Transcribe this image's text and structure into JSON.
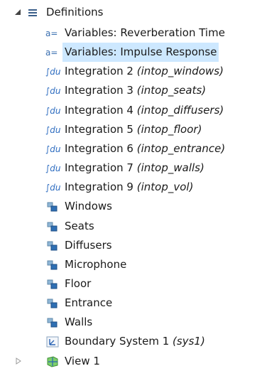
{
  "tree": {
    "definitions": {
      "label": "Definitions"
    },
    "children": [
      {
        "kind": "variables",
        "label": "Variables: Reverberation Time",
        "tag": "",
        "icon": "variables-icon",
        "icon_text": "a="
      },
      {
        "kind": "variables",
        "label": "Variables: Impulse Response",
        "tag": "",
        "icon": "variables-icon",
        "icon_text": "a=",
        "selected": true
      },
      {
        "kind": "integration",
        "label": "Integration 2",
        "tag": "(intop_windows)",
        "icon": "integration-icon",
        "icon_text": "∫du"
      },
      {
        "kind": "integration",
        "label": "Integration 3",
        "tag": "(intop_seats)",
        "icon": "integration-icon",
        "icon_text": "∫du"
      },
      {
        "kind": "integration",
        "label": "Integration 4",
        "tag": "(intop_diffusers)",
        "icon": "integration-icon",
        "icon_text": "∫du"
      },
      {
        "kind": "integration",
        "label": "Integration 5",
        "tag": "(intop_floor)",
        "icon": "integration-icon",
        "icon_text": "∫du"
      },
      {
        "kind": "integration",
        "label": "Integration 6",
        "tag": "(intop_entrance)",
        "icon": "integration-icon",
        "icon_text": "∫du"
      },
      {
        "kind": "integration",
        "label": "Integration 7",
        "tag": "(intop_walls)",
        "icon": "integration-icon",
        "icon_text": "∫du"
      },
      {
        "kind": "integration",
        "label": "Integration 9",
        "tag": "(intop_vol)",
        "icon": "integration-icon",
        "icon_text": "∫du"
      },
      {
        "kind": "selection",
        "label": "Windows",
        "tag": "",
        "icon": "selection-icon"
      },
      {
        "kind": "selection",
        "label": "Seats",
        "tag": "",
        "icon": "selection-icon"
      },
      {
        "kind": "selection",
        "label": "Diffusers",
        "tag": "",
        "icon": "selection-icon"
      },
      {
        "kind": "selection",
        "label": "Microphone",
        "tag": "",
        "icon": "selection-icon"
      },
      {
        "kind": "selection",
        "label": "Floor",
        "tag": "",
        "icon": "selection-icon"
      },
      {
        "kind": "selection",
        "label": "Entrance",
        "tag": "",
        "icon": "selection-icon"
      },
      {
        "kind": "selection",
        "label": "Walls",
        "tag": "",
        "icon": "selection-icon"
      },
      {
        "kind": "system",
        "label": "Boundary System 1",
        "tag": "(sys1)",
        "icon": "boundary-system-icon"
      },
      {
        "kind": "view",
        "label": "View 1",
        "tag": "",
        "icon": "view-icon"
      }
    ]
  },
  "colors": {
    "selection_bg": "#cde8ff",
    "variables_icon": "#3a6fb0",
    "integration_icon": "#2d6cc0"
  }
}
